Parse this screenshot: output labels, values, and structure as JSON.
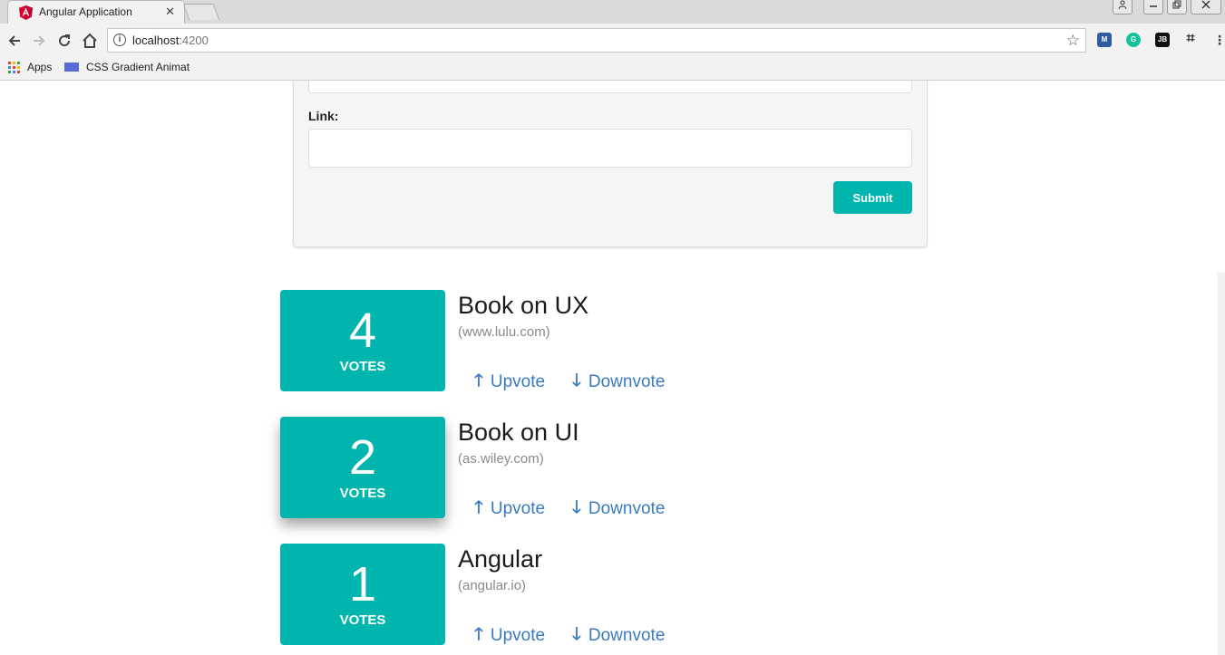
{
  "browser": {
    "tab_title": "Angular Application",
    "tab_close": "✕",
    "url_host": "localhost",
    "url_port": ":4200",
    "bookmarks": [
      {
        "label": "Apps"
      },
      {
        "label": "CSS Gradient Animat"
      }
    ],
    "extensions": [
      "JB"
    ]
  },
  "form": {
    "link_label": "Link:",
    "submit_label": "Submit"
  },
  "votes_label": "VOTES",
  "upvote_label": "Upvote",
  "downvote_label": "Downvote",
  "articles": [
    {
      "votes": "4",
      "title": "Book on UX",
      "domain": "(www.lulu.com)"
    },
    {
      "votes": "2",
      "title": "Book on UI",
      "domain": "(as.wiley.com)"
    },
    {
      "votes": "1",
      "title": "Angular",
      "domain": "(angular.io)"
    }
  ],
  "colors": {
    "accent": "#00b5ad",
    "link": "#3a7bc0"
  }
}
